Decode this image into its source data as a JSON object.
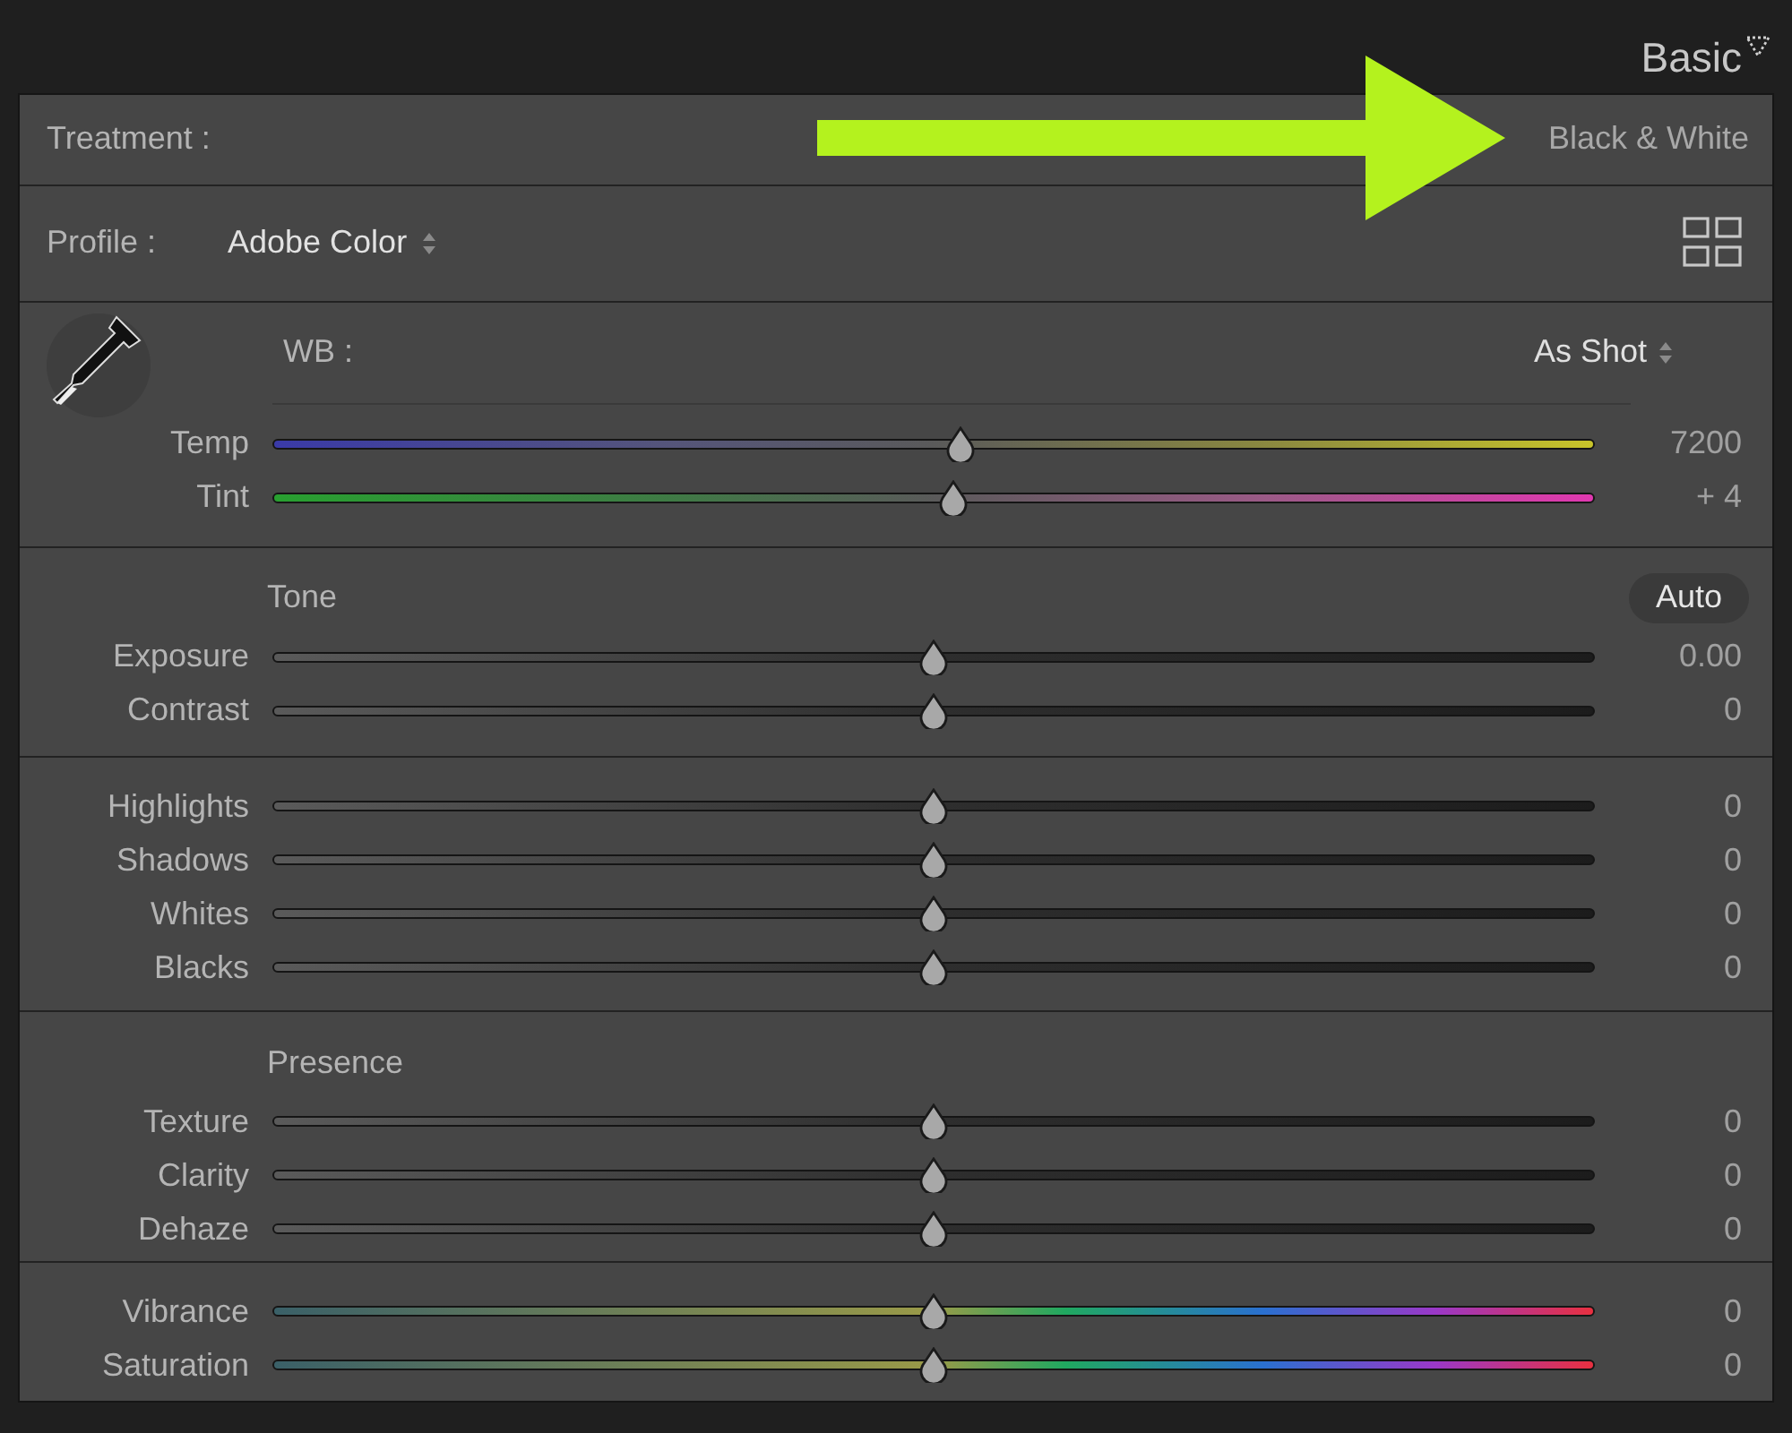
{
  "header": {
    "title": "Basic"
  },
  "treatment": {
    "label": "Treatment :",
    "value": "Black & White"
  },
  "profile": {
    "label": "Profile :",
    "value": "Adobe Color"
  },
  "white_balance": {
    "label": "WB :",
    "value": "As Shot",
    "sliders": [
      {
        "label": "Temp",
        "kind": "temp",
        "level": 0.52,
        "value": "7200"
      },
      {
        "label": "Tint",
        "kind": "tint",
        "level": 0.515,
        "value": "+ 4"
      }
    ]
  },
  "groups": [
    {
      "title": "Tone",
      "button": "Auto",
      "sliders": [
        {
          "label": "Exposure",
          "kind": "plain",
          "level": 0.5,
          "value": "0.00"
        },
        {
          "label": "Contrast",
          "kind": "plain",
          "level": 0.5,
          "value": "0"
        }
      ]
    },
    {
      "sliders": [
        {
          "label": "Highlights",
          "kind": "plain",
          "level": 0.5,
          "value": "0"
        },
        {
          "label": "Shadows",
          "kind": "plain",
          "level": 0.5,
          "value": "0"
        },
        {
          "label": "Whites",
          "kind": "plain",
          "level": 0.5,
          "value": "0"
        },
        {
          "label": "Blacks",
          "kind": "plain",
          "level": 0.5,
          "value": "0"
        }
      ]
    },
    {
      "title": "Presence",
      "sliders": [
        {
          "label": "Texture",
          "kind": "plain",
          "level": 0.5,
          "value": "0"
        },
        {
          "label": "Clarity",
          "kind": "plain",
          "level": 0.5,
          "value": "0"
        },
        {
          "label": "Dehaze",
          "kind": "plain",
          "level": 0.5,
          "value": "0"
        }
      ]
    },
    {
      "sliders": [
        {
          "label": "Vibrance",
          "kind": "color",
          "level": 0.5,
          "value": "0"
        },
        {
          "label": "Saturation",
          "kind": "color",
          "level": 0.5,
          "value": "0"
        }
      ]
    }
  ]
}
